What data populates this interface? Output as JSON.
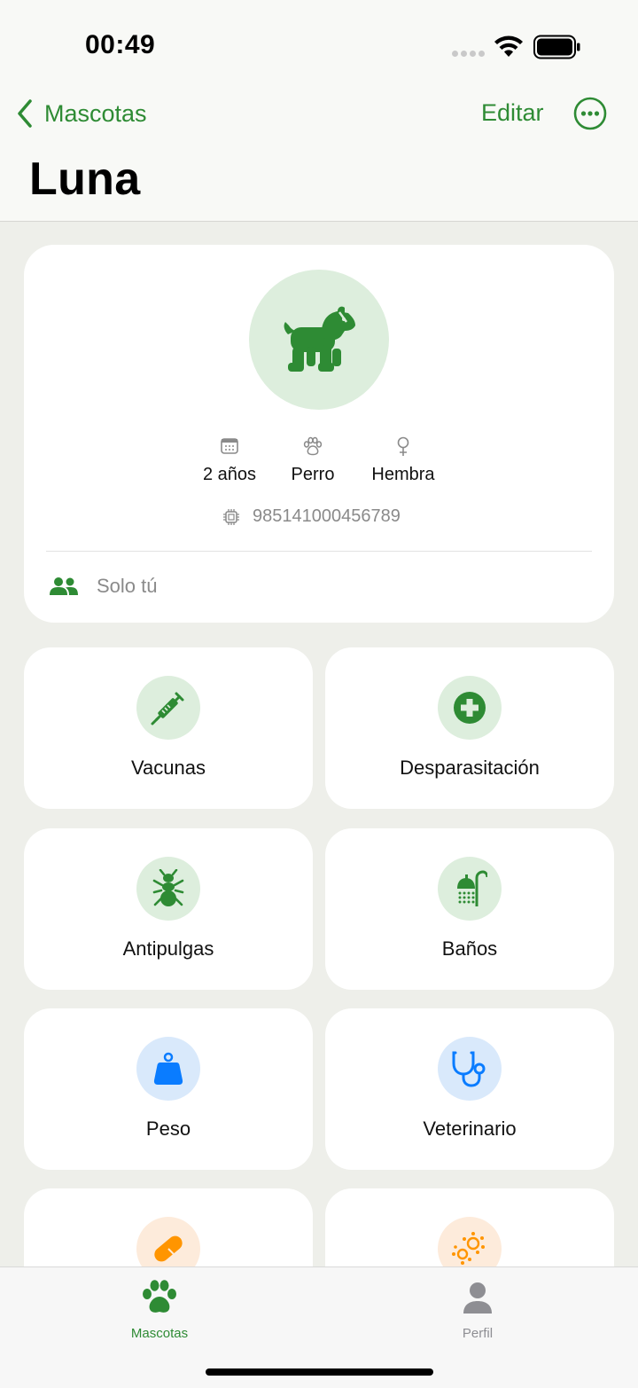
{
  "status_bar": {
    "time": "00:49"
  },
  "nav": {
    "back_label": "Mascotas",
    "edit_label": "Editar",
    "title": "Luna"
  },
  "profile": {
    "age": "2 años",
    "species": "Perro",
    "sex": "Hembra",
    "microchip": "985141000456789",
    "sharing": "Solo tú"
  },
  "categories": [
    {
      "label": "Vacunas",
      "icon": "syringe-icon",
      "color": "#2E8B34"
    },
    {
      "label": "Desparasitación",
      "icon": "cross-circle-icon",
      "color": "#2E8B34"
    },
    {
      "label": "Antipulgas",
      "icon": "ant-icon",
      "color": "#2E8B34"
    },
    {
      "label": "Baños",
      "icon": "shower-icon",
      "color": "#2E8B34"
    },
    {
      "label": "Peso",
      "icon": "scale-weight-icon",
      "color": "#0A7CFF"
    },
    {
      "label": "Veterinario",
      "icon": "stethoscope-icon",
      "color": "#0A7CFF"
    },
    {
      "label": "",
      "icon": "pill-icon",
      "color": "#FF9500"
    },
    {
      "label": "",
      "icon": "allergens-icon",
      "color": "#FF9500"
    }
  ],
  "tabs": [
    {
      "label": "Mascotas",
      "icon": "paw-icon",
      "active": true
    },
    {
      "label": "Perfil",
      "icon": "person-icon",
      "active": false
    }
  ],
  "colors": {
    "accent": "#2E8B34",
    "blue": "#0A7CFF",
    "orange": "#FF9500"
  }
}
